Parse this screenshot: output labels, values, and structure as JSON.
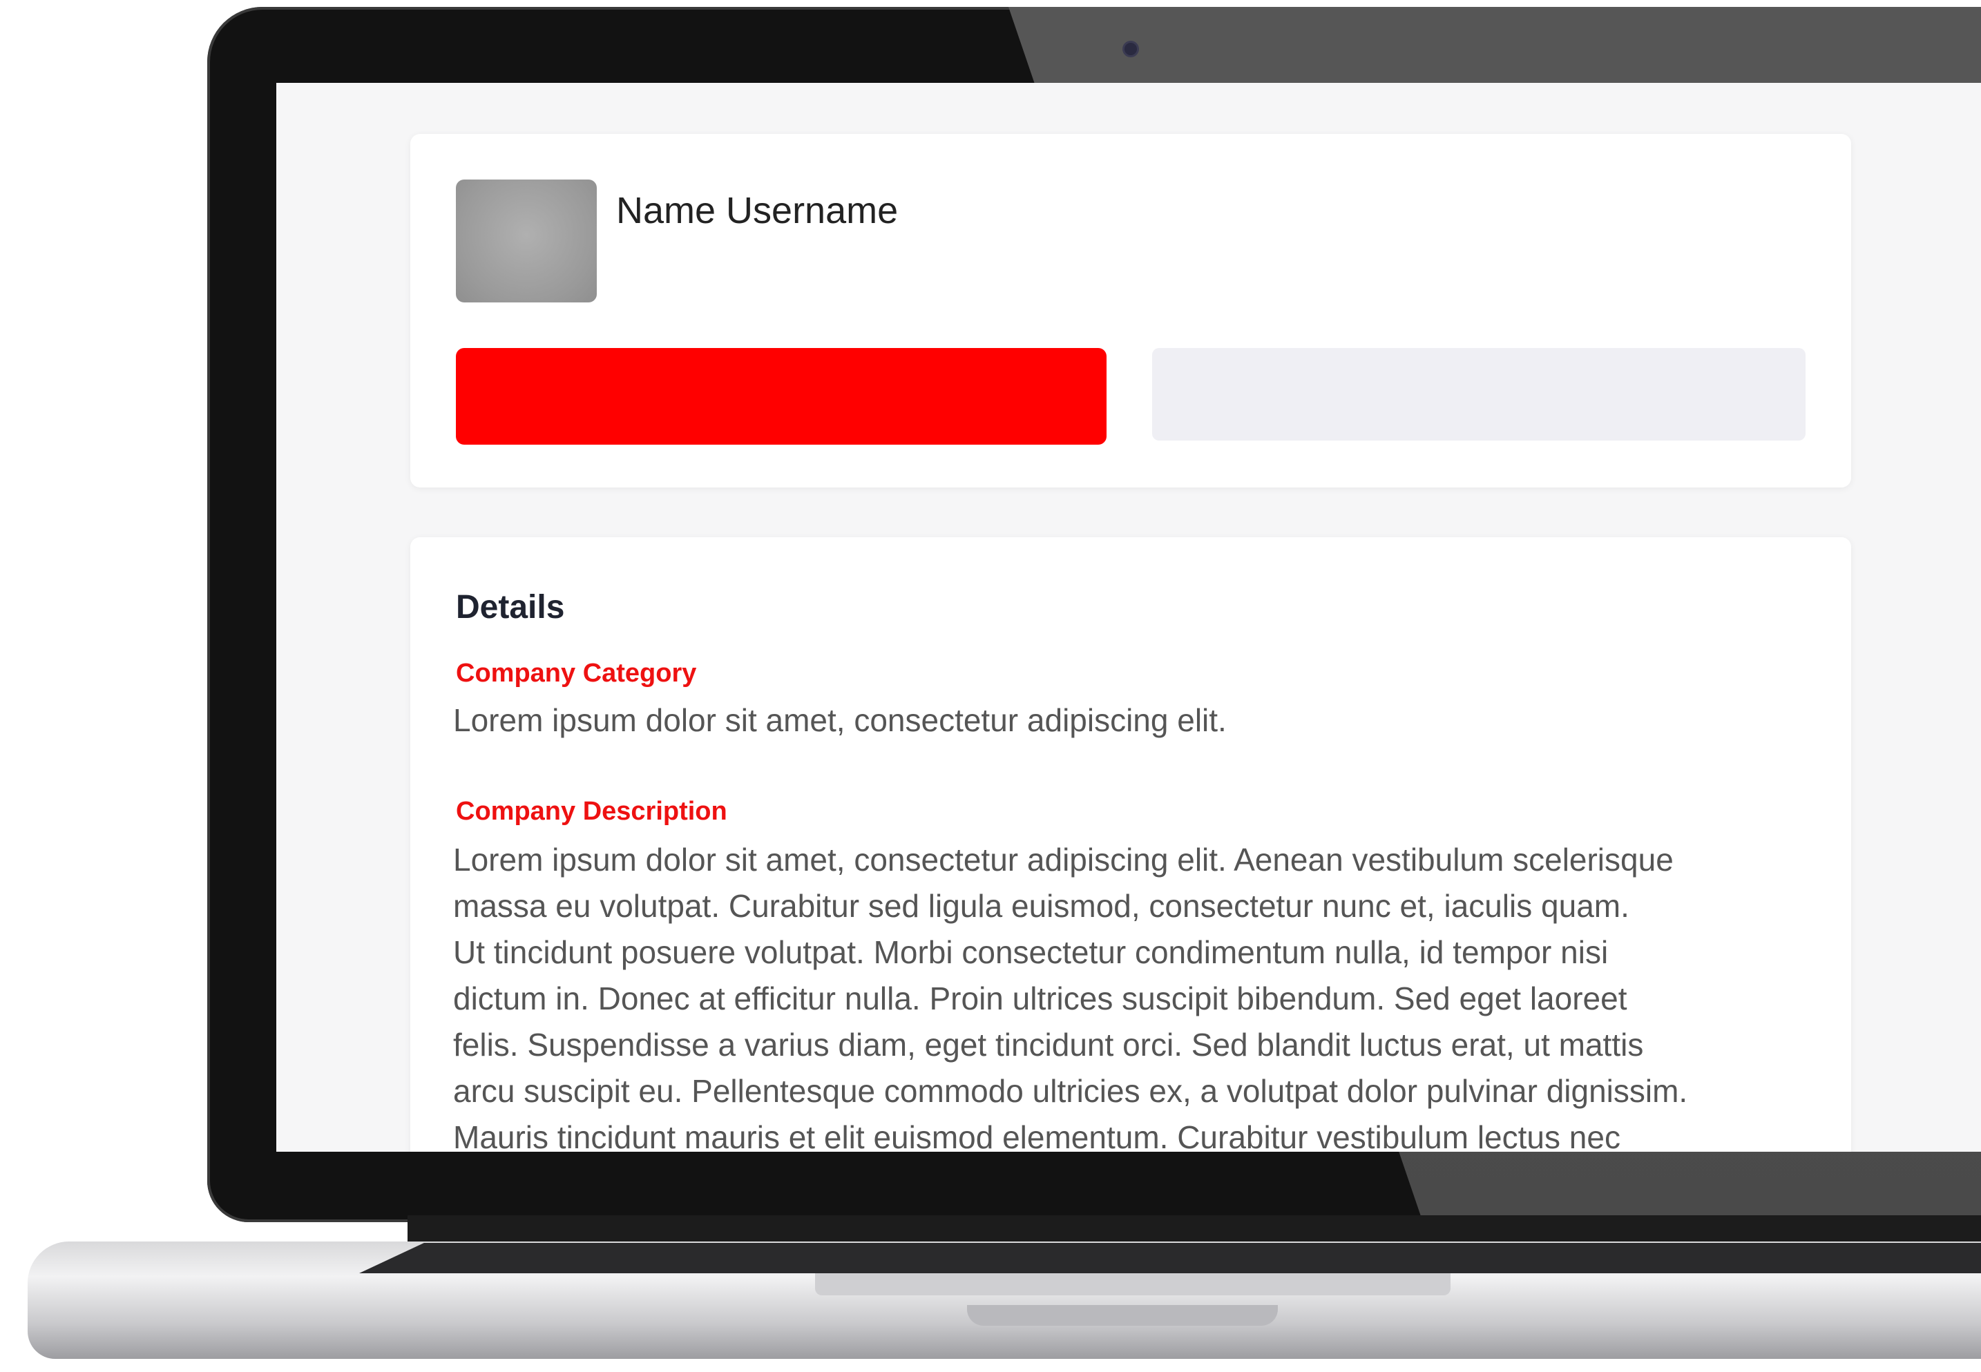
{
  "profile": {
    "name": "Name Username",
    "avatar_icon": "avatar-placeholder",
    "primary_button_color": "#ff0000",
    "secondary_button_color": "#efeff4"
  },
  "details": {
    "title": "Details",
    "category_label": "Company Category",
    "category_value": "Lorem ipsum dolor sit amet, consectetur adipiscing elit.",
    "description_label": "Company Description",
    "description_lines": [
      "Lorem ipsum dolor sit amet, consectetur adipiscing elit. Aenean vestibulum scelerisque",
      "massa eu volutpat. Curabitur sed ligula euismod, consectetur nunc et, iaculis quam.",
      "Ut tincidunt posuere volutpat. Morbi consectetur condimentum nulla, id tempor nisi",
      "dictum in. Donec at efficitur nulla. Proin ultrices suscipit bibendum. Sed eget laoreet",
      "felis. Suspendisse a varius diam, eget tincidunt orci. Sed blandit luctus erat, ut mattis",
      "arcu suscipit eu. Pellentesque commodo ultricies ex, a volutpat dolor pulvinar dignissim.",
      "Mauris tincidunt mauris et elit euismod elementum. Curabitur vestibulum lectus nec"
    ]
  },
  "colors": {
    "accent": "#ff0000",
    "label_red": "#ee1111",
    "screen_bg": "#f6f6f7"
  }
}
